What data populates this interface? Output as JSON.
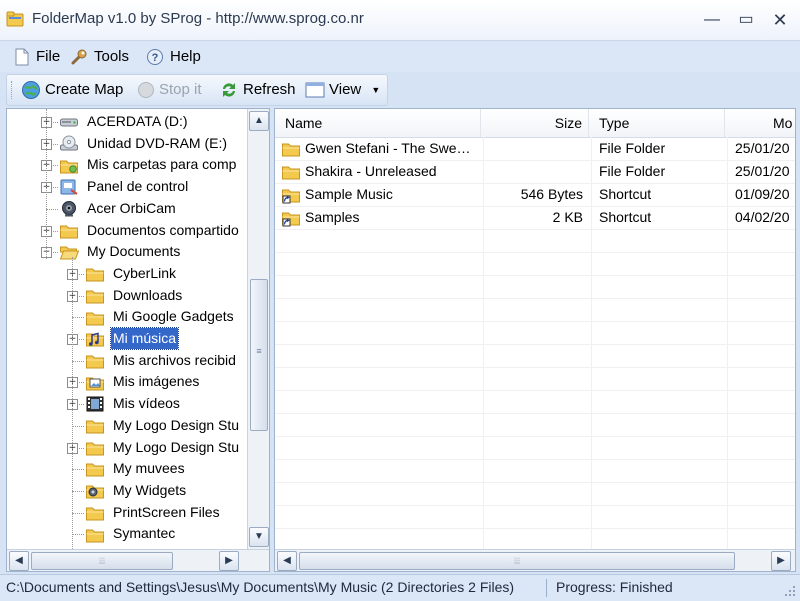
{
  "window": {
    "title": "FolderMap v1.0 by SProg - http://www.sprog.co.nr",
    "minimize_glyph": "—",
    "maximize_glyph": "▭",
    "close_glyph": "✕"
  },
  "menu": {
    "file": "File",
    "tools": "Tools",
    "help": "Help"
  },
  "toolbar": {
    "create_map": "Create Map",
    "stop_it": "Stop it",
    "refresh": "Refresh",
    "view": "View"
  },
  "tree": {
    "items": [
      {
        "label": "ACERDATA (D:)",
        "icon": "drive-icon",
        "expander": "+",
        "level": 0
      },
      {
        "label": "Unidad DVD-RAM (E:)",
        "icon": "dvd-drive-icon",
        "expander": "+",
        "level": 0
      },
      {
        "label": "Mis carpetas para comp",
        "icon": "shared-folders-icon",
        "expander": "+",
        "level": 0
      },
      {
        "label": "Panel de control",
        "icon": "control-panel-icon",
        "expander": "+",
        "level": 0
      },
      {
        "label": "Acer OrbiCam",
        "icon": "webcam-icon",
        "expander": "",
        "level": 0
      },
      {
        "label": "Documentos compartido",
        "icon": "folder-icon",
        "expander": "+",
        "level": 0
      },
      {
        "label": "My Documents",
        "icon": "folder-open-icon",
        "expander": "−",
        "level": 0
      },
      {
        "label": "CyberLink",
        "icon": "folder-icon",
        "expander": "+",
        "level": 1
      },
      {
        "label": "Downloads",
        "icon": "folder-icon",
        "expander": "+",
        "level": 1
      },
      {
        "label": "Mi Google Gadgets",
        "icon": "folder-icon",
        "expander": "",
        "level": 1
      },
      {
        "label": "Mi música",
        "icon": "music-folder-icon",
        "expander": "+",
        "level": 1,
        "selected": true
      },
      {
        "label": "Mis archivos recibid",
        "icon": "folder-icon",
        "expander": "",
        "level": 1
      },
      {
        "label": "Mis imágenes",
        "icon": "pictures-folder-icon",
        "expander": "+",
        "level": 1
      },
      {
        "label": "Mis vídeos",
        "icon": "videos-folder-icon",
        "expander": "+",
        "level": 1
      },
      {
        "label": "My Logo Design Stu",
        "icon": "folder-icon",
        "expander": "",
        "level": 1
      },
      {
        "label": "My Logo Design Stu",
        "icon": "folder-icon",
        "expander": "+",
        "level": 1
      },
      {
        "label": "My muvees",
        "icon": "folder-icon",
        "expander": "",
        "level": 1
      },
      {
        "label": "My Widgets",
        "icon": "widgets-folder-icon",
        "expander": "",
        "level": 1
      },
      {
        "label": "PrintScreen Files",
        "icon": "folder-icon",
        "expander": "",
        "level": 1
      },
      {
        "label": "Symantec",
        "icon": "folder-icon",
        "expander": "",
        "level": 1
      }
    ]
  },
  "list": {
    "columns": [
      {
        "label": "Name",
        "align": "left"
      },
      {
        "label": "Size",
        "align": "right"
      },
      {
        "label": "Type",
        "align": "left"
      },
      {
        "label": "Mo",
        "align": "left"
      }
    ],
    "rows": [
      {
        "name": "Gwen Stefani - The Swe…",
        "size": "",
        "type": "File Folder",
        "modified": "25/01/20",
        "icon": "folder-icon"
      },
      {
        "name": "Shakira - Unreleased",
        "size": "",
        "type": "File Folder",
        "modified": "25/01/20",
        "icon": "folder-icon"
      },
      {
        "name": "Sample Music",
        "size": "546 Bytes",
        "type": "Shortcut",
        "modified": "01/09/20",
        "icon": "folder-shortcut-icon"
      },
      {
        "name": "Samples",
        "size": "2 KB",
        "type": "Shortcut",
        "modified": "04/02/20",
        "icon": "folder-shortcut-icon"
      }
    ]
  },
  "status": {
    "path": "C:\\Documents and Settings\\Jesus\\My Documents\\My Music (2 Directories 2 Files)",
    "progress": "Progress: Finished"
  },
  "colors": {
    "folder_fill": "#f3c94e",
    "folder_stroke": "#c7941f",
    "selection": "#3367c9",
    "chrome": "#dbe7f7"
  }
}
